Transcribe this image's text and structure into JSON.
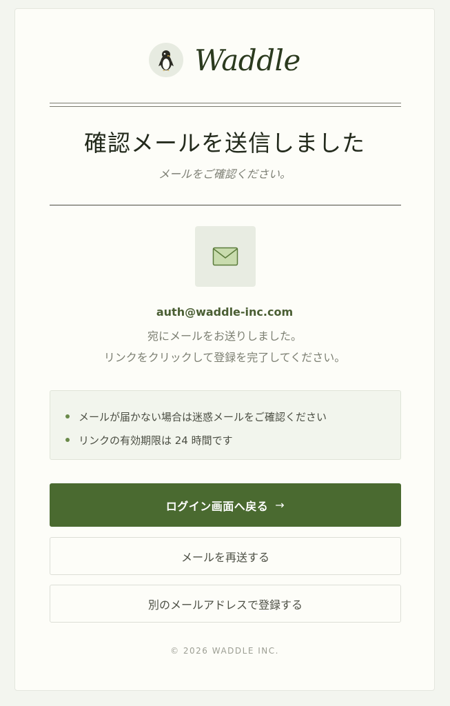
{
  "brand": {
    "name": "Waddle"
  },
  "heading": {
    "title": "確認メールを送信しました",
    "subtitle": "メールをご確認ください。"
  },
  "message": {
    "email": "auth@waddle-inc.com",
    "line1": "宛にメールをお送りしました。",
    "line2": "リンクをクリックして登録を完了してください。"
  },
  "notes": [
    "メールが届かない場合は迷惑メールをご確認ください",
    "リンクの有効期限は 24 時間です"
  ],
  "actions": {
    "login_label": "ログイン画面へ戻る",
    "login_arrow": "→",
    "resend_label": "メールを再送する",
    "other_email_label": "別のメールアドレスで登録する"
  },
  "footer": {
    "copyright": "© 2026 WADDLE INC."
  },
  "colors": {
    "accent": "#4a6a30",
    "background": "#f3f5ef",
    "card": "#fdfdf8"
  },
  "icons": {
    "logo": "penguin-icon",
    "mail": "envelope-icon"
  }
}
